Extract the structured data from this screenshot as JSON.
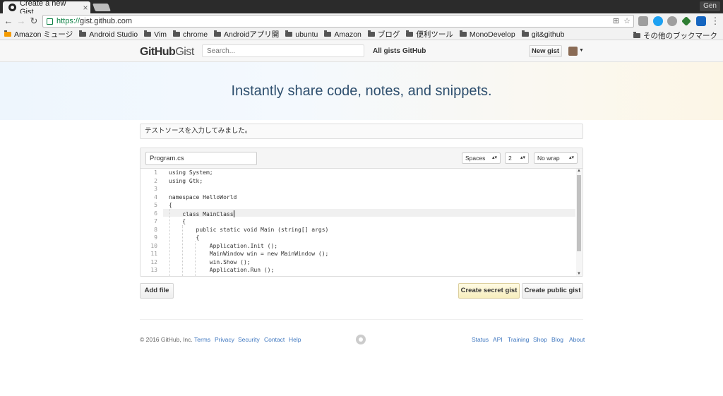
{
  "browser": {
    "tab_title": "Create a new Gist",
    "tab_close": "×",
    "profile": "Gen",
    "url_scheme": "https://",
    "url_host": "gist.github.com",
    "nav_back": "←",
    "nav_forward": "→",
    "nav_reload": "↻",
    "bookmarks": [
      "Amazon ミュージ",
      "Android Studio",
      "Vim",
      "chrome",
      "Androidアプリ開",
      "ubuntu",
      "Amazon",
      "ブログ",
      "便利ツール",
      "MonoDevelop",
      "git&github"
    ],
    "other_bookmarks": "その他のブックマーク"
  },
  "header": {
    "logo_github": "GitHub",
    "logo_gist": "Gist",
    "search_placeholder": "Search...",
    "all_gists": "All gists",
    "github": "GitHub",
    "new_gist": "New gist"
  },
  "hero": {
    "title": "Instantly share code, notes, and snippets."
  },
  "form": {
    "description": "テストソースを入力してみました。",
    "filename": "Program.cs",
    "indent_mode": "Spaces",
    "indent_size": "2",
    "wrap_mode": "No wrap",
    "line_numbers": [
      "1",
      "2",
      "3",
      "4",
      "5",
      "6",
      "7",
      "8",
      "9",
      "10",
      "11",
      "12",
      "13"
    ],
    "code_lines": [
      "using System;",
      "using Gtk;",
      "",
      "namespace HelloWorld",
      "{",
      "    class MainClass",
      "    {",
      "        public static void Main (string[] args)",
      "        {",
      "            Application.Init ();",
      "            MainWindow win = new MainWindow ();",
      "            win.Show ();",
      "            Application.Run ();"
    ],
    "add_file": "Add file",
    "create_secret": "Create secret gist",
    "create_public": "Create public gist"
  },
  "footer": {
    "copyright": "© 2016 GitHub, Inc.",
    "left_links": [
      "Terms",
      "Privacy",
      "Security",
      "Contact",
      "Help"
    ],
    "right_links": [
      "Status",
      "API",
      "Training",
      "Shop",
      "Blog",
      "About"
    ]
  }
}
